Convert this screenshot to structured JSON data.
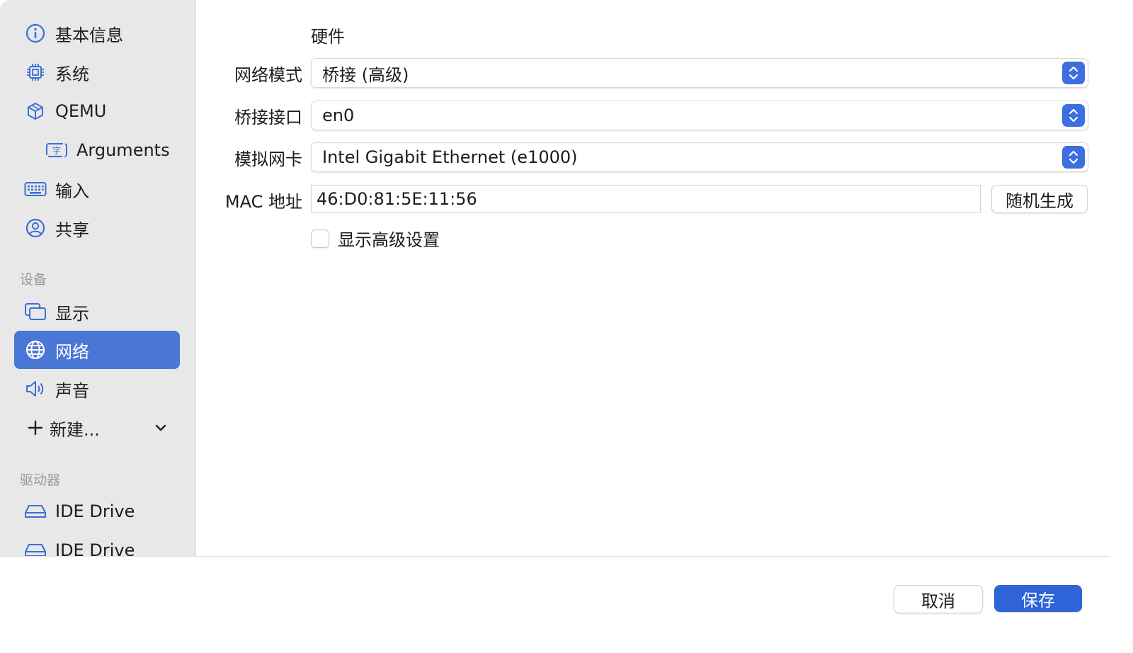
{
  "colors": {
    "accent": "#2f63d8",
    "sidebar_selected": "#4a77d6",
    "icon_blue": "#3a6fd8"
  },
  "sidebar": {
    "items": [
      {
        "label": "基本信息",
        "icon": "info-icon"
      },
      {
        "label": "系统",
        "icon": "cpu-chip-icon"
      },
      {
        "label": "QEMU",
        "icon": "cube-icon"
      },
      {
        "label": "Arguments",
        "icon": "text-input-icon"
      },
      {
        "label": "输入",
        "icon": "keyboard-icon"
      },
      {
        "label": "共享",
        "icon": "person-circle-icon"
      }
    ],
    "devices_header": "设备",
    "devices": [
      {
        "label": "显示",
        "icon": "display-windows-icon"
      },
      {
        "label": "网络",
        "icon": "globe-icon",
        "selected": true
      },
      {
        "label": "声音",
        "icon": "speaker-icon"
      }
    ],
    "new_label": "新建...",
    "drives_header": "驱动器",
    "drives": [
      {
        "label": "IDE Drive",
        "icon": "drive-icon"
      },
      {
        "label": "IDE Drive",
        "icon": "drive-icon"
      }
    ]
  },
  "form": {
    "section_title": "硬件",
    "network_mode": {
      "label": "网络模式",
      "value": "桥接 (高级)"
    },
    "bridge_interface": {
      "label": "桥接接口",
      "value": "en0"
    },
    "emulated_nic": {
      "label": "模拟网卡",
      "value": "Intel Gigabit Ethernet (e1000)"
    },
    "mac_address": {
      "label": "MAC 地址",
      "value": "46:D0:81:5E:11:56",
      "random_button": "随机生成"
    },
    "advanced_checkbox": {
      "label": "显示高级设置",
      "checked": false
    }
  },
  "footer": {
    "cancel": "取消",
    "save": "保存"
  }
}
